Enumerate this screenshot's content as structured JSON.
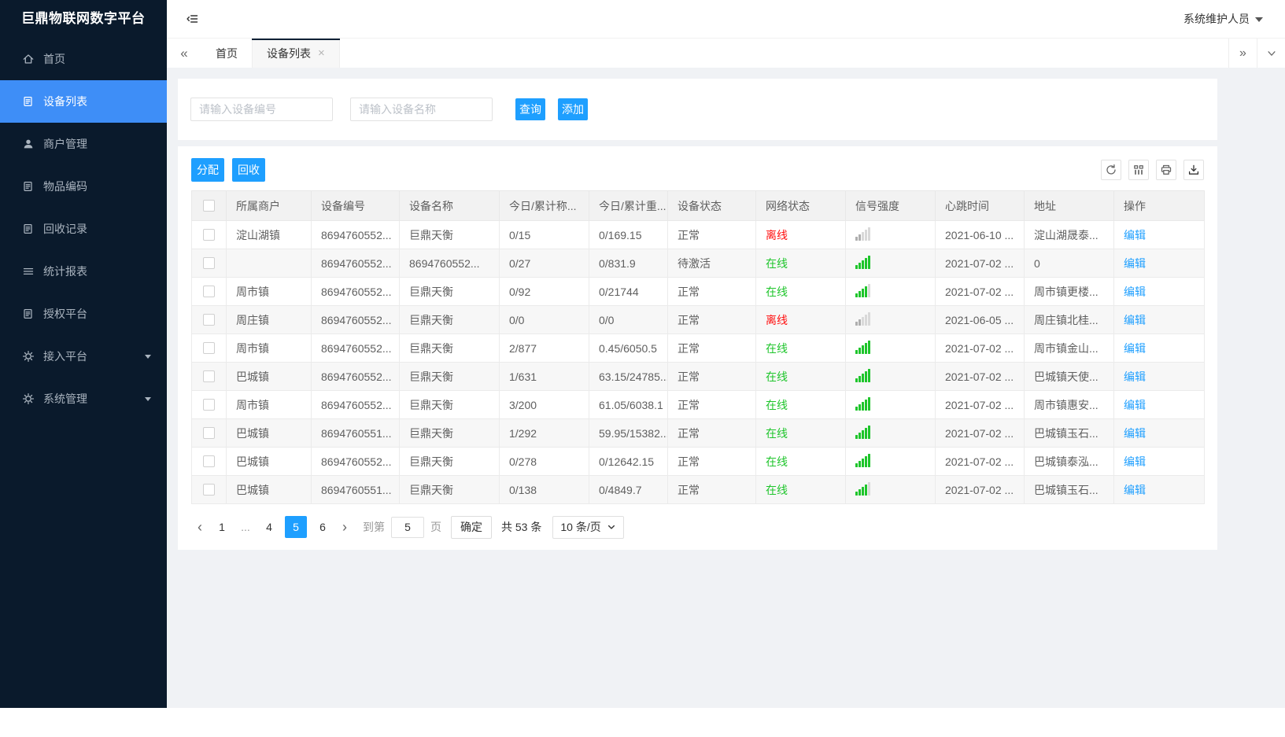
{
  "app": {
    "logo": "巨鼎物联网数字平台",
    "user": "系统维护人员"
  },
  "sidebar": {
    "items": [
      {
        "id": "home",
        "label": "首页",
        "icon": "home-icon",
        "active": false,
        "expandable": false
      },
      {
        "id": "device-list",
        "label": "设备列表",
        "icon": "doc-icon",
        "active": true,
        "expandable": false
      },
      {
        "id": "merchant-management",
        "label": "商户管理",
        "icon": "user-icon",
        "active": false,
        "expandable": false
      },
      {
        "id": "item-codes",
        "label": "物品编码",
        "icon": "doc-icon",
        "active": false,
        "expandable": false
      },
      {
        "id": "recycle-records",
        "label": "回收记录",
        "icon": "doc-icon",
        "active": false,
        "expandable": false
      },
      {
        "id": "statistics-reports",
        "label": "统计报表",
        "icon": "list-icon",
        "active": false,
        "expandable": false
      },
      {
        "id": "authorization-platform",
        "label": "授权平台",
        "icon": "doc-icon",
        "active": false,
        "expandable": false
      },
      {
        "id": "access-platform",
        "label": "接入平台",
        "icon": "gear-icon",
        "active": false,
        "expandable": true
      },
      {
        "id": "system-management",
        "label": "系统管理",
        "icon": "gear-icon",
        "active": false,
        "expandable": true
      }
    ]
  },
  "tabbar": {
    "scroll_left": "«",
    "scroll_right": "»",
    "close_glyph": "×",
    "tabs": [
      {
        "id": "home",
        "label": "首页",
        "active": false,
        "closable": false
      },
      {
        "id": "device-list",
        "label": "设备列表",
        "active": true,
        "closable": true
      }
    ]
  },
  "search": {
    "device_no_placeholder": "请输入设备编号",
    "device_name_placeholder": "请输入设备名称",
    "query_label": "查询",
    "add_label": "添加"
  },
  "toolbar": {
    "assign_label": "分配",
    "recycle_label": "回收",
    "icon_buttons": [
      "refresh-icon",
      "columns-icon",
      "print-icon",
      "export-icon"
    ]
  },
  "table": {
    "columns": [
      "所属商户",
      "设备编号",
      "设备名称",
      "今日/累计称...",
      "今日/累计重...",
      "设备状态",
      "网络状态",
      "信号强度",
      "心跳时间",
      "地址",
      "操作"
    ],
    "rows": [
      {
        "merchant": "淀山湖镇",
        "device_no": "8694760552...",
        "device_name": "巨鼎天衡",
        "today_total_count": "0/15",
        "today_total_weight": "0/169.15",
        "device_status": "正常",
        "network_status": "离线",
        "online": false,
        "signal_level": 2,
        "heartbeat": "2021-06-10 ...",
        "address": "淀山湖晟泰...",
        "action": "编辑"
      },
      {
        "merchant": "",
        "device_no": "8694760552...",
        "device_name": "8694760552...",
        "today_total_count": "0/27",
        "today_total_weight": "0/831.9",
        "device_status": "待激活",
        "network_status": "在线",
        "online": true,
        "signal_level": 5,
        "heartbeat": "2021-07-02 ...",
        "address": "0",
        "action": "编辑"
      },
      {
        "merchant": "周市镇",
        "device_no": "8694760552...",
        "device_name": "巨鼎天衡",
        "today_total_count": "0/92",
        "today_total_weight": "0/21744",
        "device_status": "正常",
        "network_status": "在线",
        "online": true,
        "signal_level": 4,
        "heartbeat": "2021-07-02 ...",
        "address": "周市镇更楼...",
        "action": "编辑"
      },
      {
        "merchant": "周庄镇",
        "device_no": "8694760552...",
        "device_name": "巨鼎天衡",
        "today_total_count": "0/0",
        "today_total_weight": "0/0",
        "device_status": "正常",
        "network_status": "离线",
        "online": false,
        "signal_level": 2,
        "heartbeat": "2021-06-05 ...",
        "address": "周庄镇北桂...",
        "action": "编辑"
      },
      {
        "merchant": "周市镇",
        "device_no": "8694760552...",
        "device_name": "巨鼎天衡",
        "today_total_count": "2/877",
        "today_total_weight": "0.45/6050.5",
        "device_status": "正常",
        "network_status": "在线",
        "online": true,
        "signal_level": 5,
        "heartbeat": "2021-07-02 ...",
        "address": "周市镇金山...",
        "action": "编辑"
      },
      {
        "merchant": "巴城镇",
        "device_no": "8694760552...",
        "device_name": "巨鼎天衡",
        "today_total_count": "1/631",
        "today_total_weight": "63.15/24785...",
        "device_status": "正常",
        "network_status": "在线",
        "online": true,
        "signal_level": 5,
        "heartbeat": "2021-07-02 ...",
        "address": "巴城镇天使...",
        "action": "编辑"
      },
      {
        "merchant": "周市镇",
        "device_no": "8694760552...",
        "device_name": "巨鼎天衡",
        "today_total_count": "3/200",
        "today_total_weight": "61.05/6038.1",
        "device_status": "正常",
        "network_status": "在线",
        "online": true,
        "signal_level": 5,
        "heartbeat": "2021-07-02 ...",
        "address": "周市镇惠安...",
        "action": "编辑"
      },
      {
        "merchant": "巴城镇",
        "device_no": "8694760551...",
        "device_name": "巨鼎天衡",
        "today_total_count": "1/292",
        "today_total_weight": "59.95/15382...",
        "device_status": "正常",
        "network_status": "在线",
        "online": true,
        "signal_level": 5,
        "heartbeat": "2021-07-02 ...",
        "address": "巴城镇玉石...",
        "action": "编辑"
      },
      {
        "merchant": "巴城镇",
        "device_no": "8694760552...",
        "device_name": "巨鼎天衡",
        "today_total_count": "0/278",
        "today_total_weight": "0/12642.15",
        "device_status": "正常",
        "network_status": "在线",
        "online": true,
        "signal_level": 5,
        "heartbeat": "2021-07-02 ...",
        "address": "巴城镇泰泓...",
        "action": "编辑"
      },
      {
        "merchant": "巴城镇",
        "device_no": "8694760551...",
        "device_name": "巨鼎天衡",
        "today_total_count": "0/138",
        "today_total_weight": "0/4849.7",
        "device_status": "正常",
        "network_status": "在线",
        "online": true,
        "signal_level": 4,
        "heartbeat": "2021-07-02 ...",
        "address": "巴城镇玉石...",
        "action": "编辑"
      }
    ]
  },
  "pagination": {
    "prev_glyph": "‹",
    "next_glyph": "›",
    "pages": [
      "1",
      "...",
      "4",
      "5",
      "6"
    ],
    "active_page": "5",
    "goto_label": "到第",
    "goto_value": "5",
    "page_unit": "页",
    "confirm_label": "确定",
    "total_text": "共 53 条",
    "page_size_value": "10 条/页"
  },
  "colors": {
    "accent": "#1E9FFF",
    "sidebar_bg": "#0a1a2c",
    "sidebar_active": "#3e8ef7",
    "online_green": "#1ec52b",
    "offline_red": "#ff1010",
    "link_blue": "#1E9FFF"
  }
}
